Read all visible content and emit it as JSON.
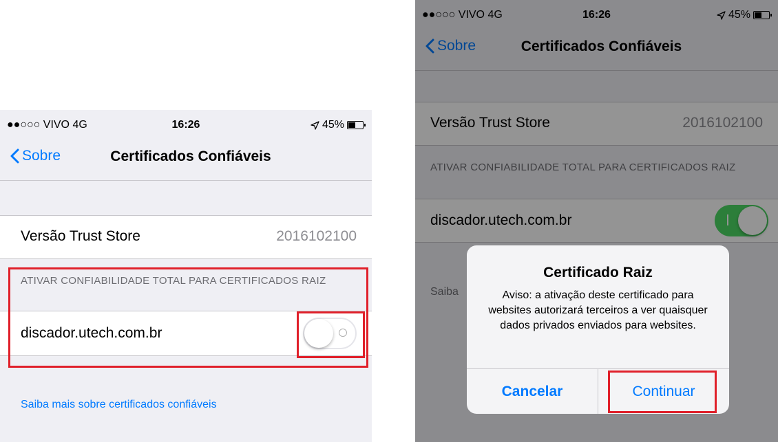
{
  "left_screen": {
    "status": {
      "carrier": "●●○○○ VIVO  4G",
      "time": "16:26",
      "battery": "45%",
      "battery_level": 0.45
    },
    "nav": {
      "back_label": "Sobre",
      "title": "Certificados Confiáveis"
    },
    "trust_store": {
      "label": "Versão Trust Store",
      "value": "2016102100"
    },
    "section_header": "ATIVAR CONFIABILIDADE TOTAL PARA CERTIFICADOS RAIZ",
    "certificate": {
      "label": "discador.utech.com.br",
      "enabled": false
    },
    "footer_link": "Saiba mais sobre certificados confiáveis"
  },
  "right_screen": {
    "status": {
      "carrier": "●●○○○ VIVO  4G",
      "time": "16:26",
      "battery": "45%",
      "battery_level": 0.45
    },
    "nav": {
      "back_label": "Sobre",
      "title": "Certificados Confiáveis"
    },
    "trust_store": {
      "label": "Versão Trust Store",
      "value": "2016102100"
    },
    "section_header": "ATIVAR CONFIABILIDADE TOTAL PARA CERTIFICADOS RAIZ",
    "certificate": {
      "label": "discador.utech.com.br",
      "enabled": true
    },
    "footer_partial": "Saiba",
    "alert": {
      "title": "Certificado Raiz",
      "message": "Aviso: a ativação deste certificado para websites autorizará terceiros a ver quaisquer dados privados enviados para websites.",
      "cancel_label": "Cancelar",
      "continue_label": "Continuar"
    }
  },
  "colors": {
    "accent": "#007aff",
    "toggle_on": "#4cd964",
    "highlight": "#e0202a"
  }
}
